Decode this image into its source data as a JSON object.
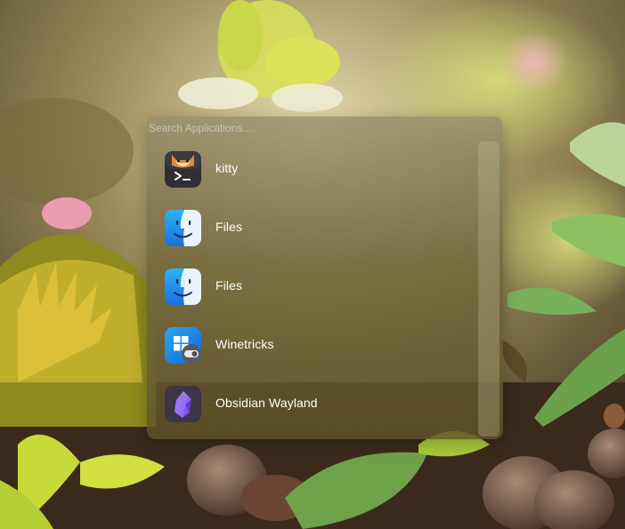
{
  "search": {
    "placeholder": "Search Applications..."
  },
  "apps": [
    {
      "label": "kitty",
      "icon": "kitty-terminal-icon"
    },
    {
      "label": "Files",
      "icon": "finder-icon"
    },
    {
      "label": "Files",
      "icon": "finder-icon"
    },
    {
      "label": "Winetricks",
      "icon": "winetricks-icon"
    },
    {
      "label": "Obsidian Wayland",
      "icon": "obsidian-icon"
    }
  ],
  "colors": {
    "panel_tint": "#6e6238",
    "text": "#ffffff",
    "finder_blue": "#1e88e5",
    "obsidian_purple": "#8a5cf6"
  }
}
